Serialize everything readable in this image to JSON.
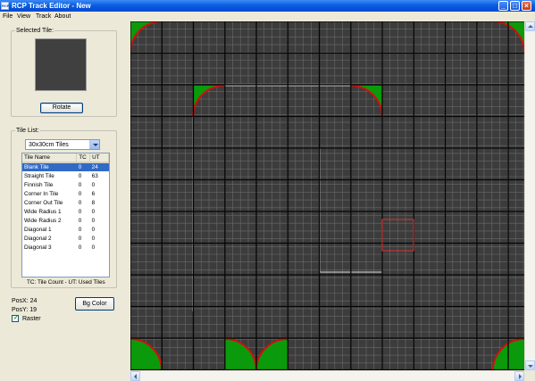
{
  "window": {
    "title": "RCP Track Editor - New",
    "icon_text": "RCP"
  },
  "title_buttons": {
    "minimize": "_",
    "maximize": "□",
    "close": "×"
  },
  "menu": {
    "items": [
      "File",
      "View",
      "Track",
      "About"
    ]
  },
  "selected_tile": {
    "group_label": "Selected Tile:",
    "rotate_label": "Rotate"
  },
  "tile_list": {
    "group_label": "Tile List:",
    "select_value": "30x30cm Tiles",
    "columns": [
      "Tile Name",
      "TC",
      "UT"
    ],
    "rows": [
      {
        "name": "Blank Tile",
        "tc": "0",
        "ut": "24",
        "selected": true
      },
      {
        "name": "Straight Tile",
        "tc": "0",
        "ut": "63"
      },
      {
        "name": "Finnish Tile",
        "tc": "0",
        "ut": "0"
      },
      {
        "name": "Corner In Tile",
        "tc": "0",
        "ut": "6"
      },
      {
        "name": "Corner Out Tile",
        "tc": "0",
        "ut": "8"
      },
      {
        "name": "Wide Radius 1",
        "tc": "0",
        "ut": "0"
      },
      {
        "name": "Wide Radius 2",
        "tc": "0",
        "ut": "0"
      },
      {
        "name": "Diagonal 1",
        "tc": "0",
        "ut": "0"
      },
      {
        "name": "Diagonal 2",
        "tc": "0",
        "ut": "0"
      },
      {
        "name": "Diagonal 3",
        "tc": "0",
        "ut": "0"
      }
    ],
    "legend": "TC: Tile Count - UT: Used Tiles"
  },
  "position": {
    "posx_label": "PosX: 24",
    "posy_label": "PosY: 19"
  },
  "raster": {
    "label": "Raster",
    "checked": true
  },
  "bgcolor_button": "Bg Color",
  "colors": {
    "canvas_bg": "#3c3c3c",
    "fine_grid": "#6a6a6a",
    "major_grid": "#050505",
    "track_edge": "#d8d8d8",
    "corner_fill": "#0b9a0b",
    "corner_arc": "#d01010",
    "selection": "#e03030",
    "accent_title": "#0a5fe0",
    "selected_row": "#316ac5"
  }
}
